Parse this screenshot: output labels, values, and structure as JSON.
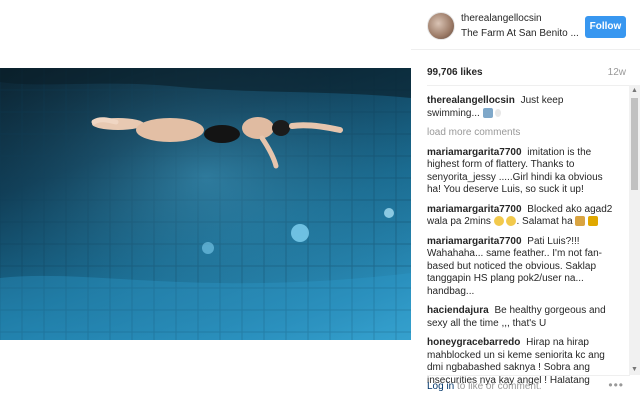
{
  "post": {
    "username": "therealangellocsin",
    "location": "The Farm At San Benito ...",
    "follow_label": "Follow",
    "likes": "99,706 likes",
    "age": "12w"
  },
  "caption": {
    "user": "therealangellocsin",
    "text": "Just keep swimming..."
  },
  "load_more": "load more comments",
  "comments": [
    {
      "user": "mariamargarita7700",
      "text": "imitation is the highest form of flattery. Thanks to senyorita_jessy .....Girl hindi ka obvious ha! You deserve Luis, so suck it up!"
    },
    {
      "user": "mariamargarita7700",
      "text": "Blocked ako agad2 wala pa 2mins",
      "text2": ". Salamat ha"
    },
    {
      "user": "mariamargarita7700",
      "text": "Pati Luis?!!! Wahahaha... same feather.. I'm not fan-based but noticed the obvious. Saklap tanggapin HS plang pok2/user na... handbag..."
    },
    {
      "user": "haciendajura",
      "text": "Be healthy gorgeous and sexy all the time ,,, that's U"
    },
    {
      "user": "honeygracebarredo",
      "text": "Hirap na hirap mahblocked un si keme seniorita kc ang dmi ngbabashed saknya ! Sobra ang insecurities nya kay angel ! Halatang"
    }
  ],
  "footer": {
    "login_link": "Log in",
    "login_rest": "to like or comment.",
    "more": "•••"
  },
  "colors": {
    "accent": "#3897f0",
    "link": "#003569",
    "muted": "#999999",
    "water": "#1a6f96"
  }
}
